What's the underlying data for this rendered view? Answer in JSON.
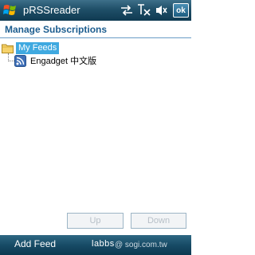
{
  "titlebar": {
    "app_title": "pRSSreader",
    "ok_label": "ok",
    "icons": [
      "start-flag-icon",
      "sync-arrows-icon",
      "signal-off-icon",
      "volume-icon"
    ]
  },
  "header": {
    "title": "Manage Subscriptions"
  },
  "tree": {
    "root": {
      "label": "My Feeds",
      "icon": "folder-icon"
    },
    "children": [
      {
        "label": "Engadget 中文版",
        "icon": "rss-feed-icon"
      }
    ]
  },
  "buttons": {
    "up_label": "Up",
    "down_label": "Down"
  },
  "softkeys": {
    "left": "Add Feed",
    "right": "labbs"
  },
  "watermark": "@ sogi.com.tw",
  "colors": {
    "accent": "#1c5d8f",
    "selection": "#3fa9e0",
    "bar": "#174b66"
  }
}
